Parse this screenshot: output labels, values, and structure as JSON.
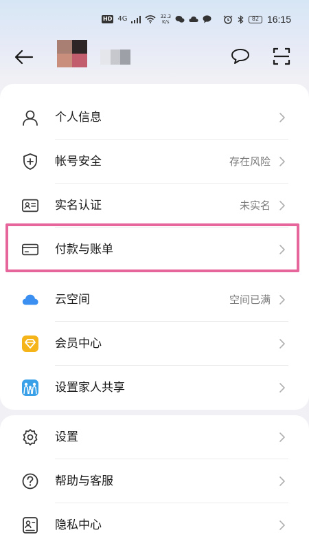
{
  "status_bar": {
    "hd": "HD",
    "network": "4G",
    "speed_value": "32.3",
    "speed_unit": "K/s",
    "battery": "82",
    "time": "16:15"
  },
  "header": {
    "back_icon": "arrow-left-icon",
    "message_icon": "chat-bubble-icon",
    "scan_icon": "scan-icon"
  },
  "menu_group_1": [
    {
      "label": "个人信息",
      "status": "",
      "icon": "person-icon"
    },
    {
      "label": "帐号安全",
      "status": "存在风险",
      "icon": "shield-plus-icon"
    },
    {
      "label": "实名认证",
      "status": "未实名",
      "icon": "id-card-icon"
    },
    {
      "label": "付款与账单",
      "status": "",
      "icon": "payment-card-icon"
    },
    {
      "label": "云空间",
      "status": "空间已满",
      "icon": "cloud-icon"
    },
    {
      "label": "会员中心",
      "status": "",
      "icon": "diamond-icon"
    },
    {
      "label": "设置家人共享",
      "status": "",
      "icon": "family-icon"
    }
  ],
  "menu_group_2": [
    {
      "label": "设置",
      "status": "",
      "icon": "gear-icon"
    },
    {
      "label": "帮助与客服",
      "status": "",
      "icon": "question-icon"
    },
    {
      "label": "隐私中心",
      "status": "",
      "icon": "privacy-icon"
    }
  ],
  "colors": {
    "highlight": "#e6659b",
    "cloud": "#3b8ff0",
    "member": "#f5b51a",
    "family": "#3aa0e8"
  }
}
